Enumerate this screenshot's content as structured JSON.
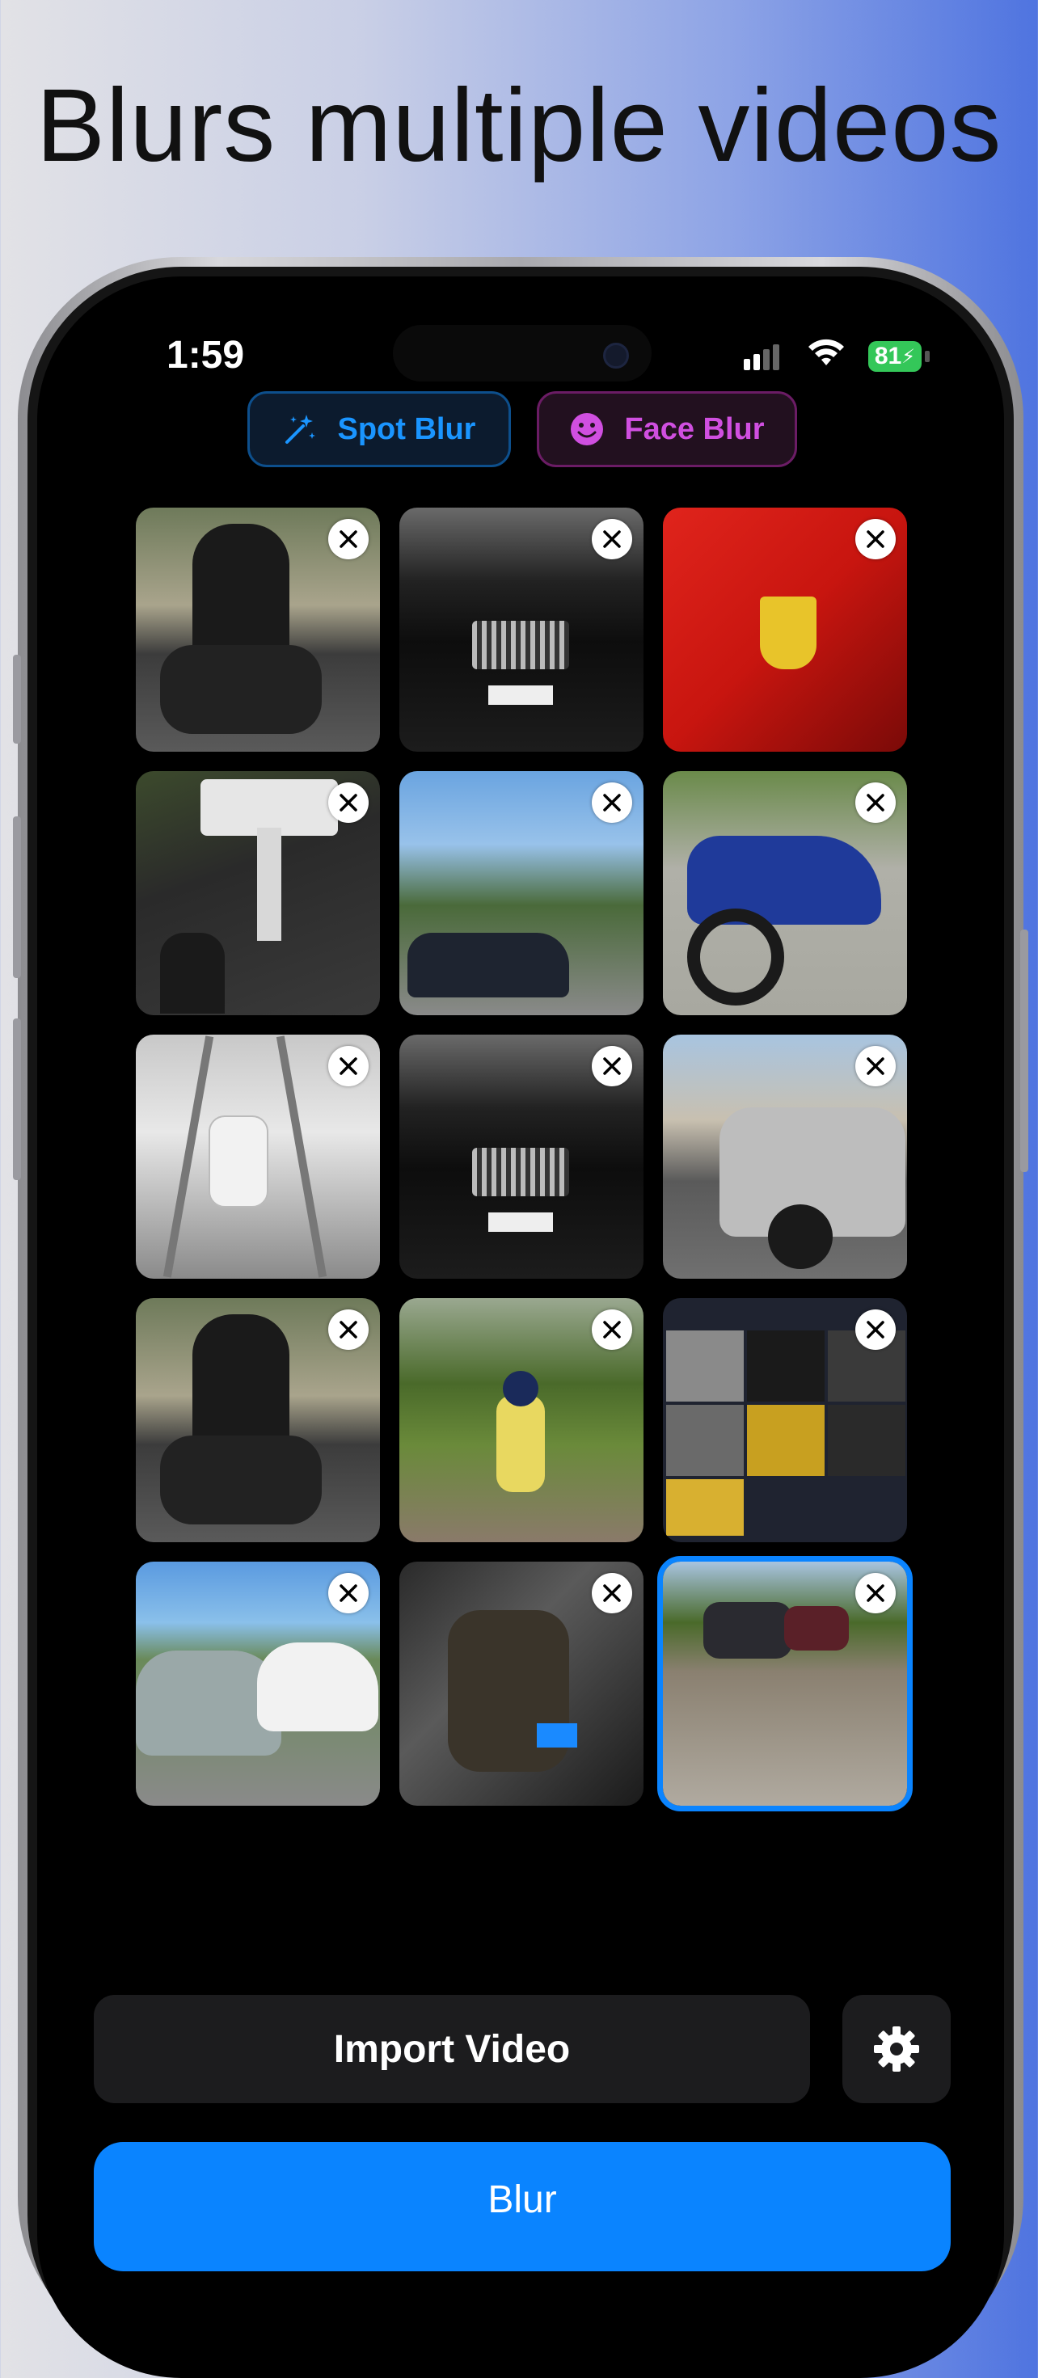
{
  "headline": "Blurs multiple videos",
  "status_bar": {
    "time": "1:59",
    "battery": "81"
  },
  "modes": [
    {
      "label": "Spot Blur",
      "icon": "magic-wand-icon",
      "color": "#1a95ff"
    },
    {
      "label": "Face Blur",
      "icon": "smiley-face-icon",
      "color": "#d04fe0"
    }
  ],
  "videos": [
    {
      "subject": "motorcycle rider on road"
    },
    {
      "subject": "black sedan front"
    },
    {
      "subject": "red car with emblem"
    },
    {
      "subject": "pickup truck and rider"
    },
    {
      "subject": "street with palm trees and SUV"
    },
    {
      "subject": "blue sport motorcycle"
    },
    {
      "subject": "white pickup truck"
    },
    {
      "subject": "black sedan front"
    },
    {
      "subject": "silver SUV on street"
    },
    {
      "subject": "motorcycle rider on road"
    },
    {
      "subject": "dirt bike rider on trail"
    },
    {
      "subject": "app screenshot grid"
    },
    {
      "subject": "parked cars"
    },
    {
      "subject": "motorcycle stunt"
    },
    {
      "subject": "ATVs in mud",
      "selected": true
    }
  ],
  "actions": {
    "import_label": "Import Video",
    "blur_label": "Blur",
    "settings_icon": "gear-icon"
  },
  "colors": {
    "accent": "#0a84ff",
    "button_bg": "#1c1c1e"
  }
}
